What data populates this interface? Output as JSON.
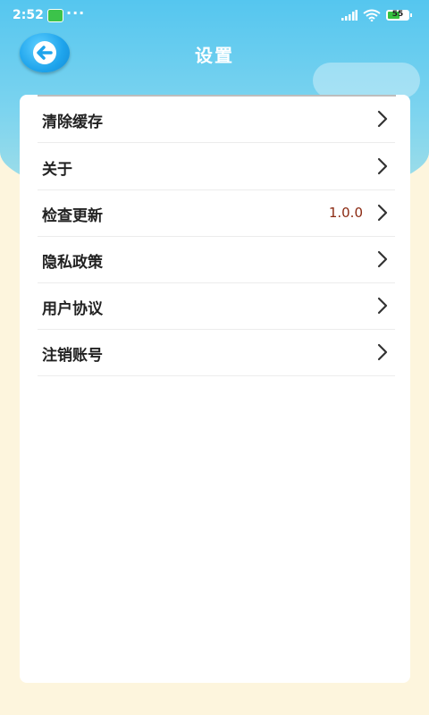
{
  "status_bar": {
    "time": "2:52",
    "dots": "···",
    "battery": "55"
  },
  "header": {
    "title": "设置"
  },
  "settings": {
    "items": [
      {
        "label": "清除缓存",
        "value": ""
      },
      {
        "label": "关于",
        "value": ""
      },
      {
        "label": "检查更新",
        "value": "1.0.0"
      },
      {
        "label": "隐私政策",
        "value": ""
      },
      {
        "label": "用户协议",
        "value": ""
      },
      {
        "label": "注销账号",
        "value": ""
      }
    ]
  },
  "colors": {
    "sky": "#55c6ef",
    "background": "#fdf5dd",
    "version_text": "#8b2a12"
  }
}
